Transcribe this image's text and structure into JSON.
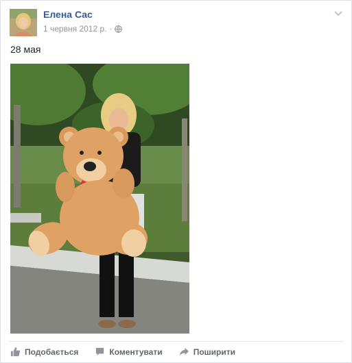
{
  "post": {
    "author_name": "Елена Сас",
    "date": "1 червня 2012 р.",
    "separator": "·",
    "privacy_icon": "globe-icon",
    "text": "28 мая",
    "photo_icon": "photo"
  },
  "actions": {
    "like_label": "Подобається",
    "comment_label": "Коментувати",
    "share_label": "Поширити"
  },
  "colors": {
    "link": "#365899",
    "secondary": "#90949c",
    "action": "#616770"
  }
}
